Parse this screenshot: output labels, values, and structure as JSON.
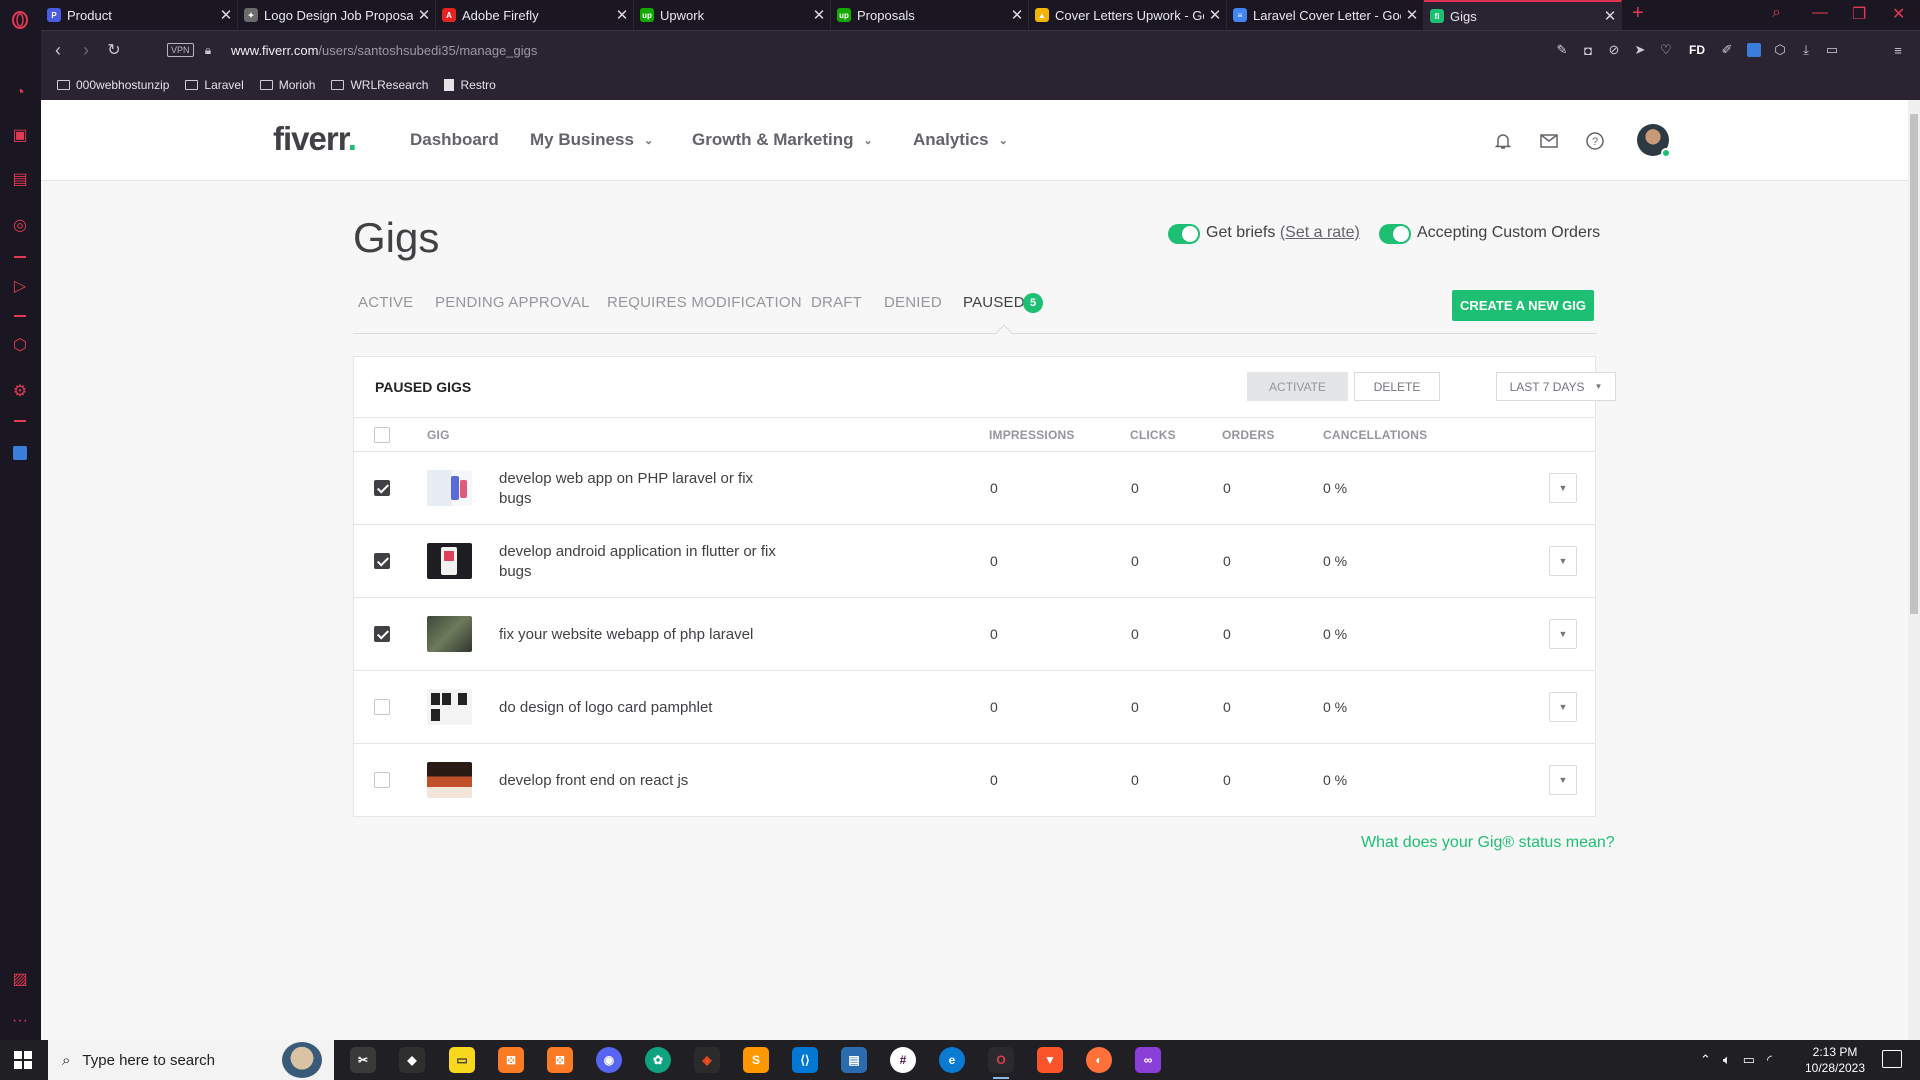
{
  "browser": {
    "tabs": [
      {
        "title": "Product",
        "color": "#4a5de0",
        "glyph": "P"
      },
      {
        "title": "Logo Design Job Proposal",
        "color": "#6b6b6b",
        "glyph": "✦"
      },
      {
        "title": "Adobe Firefly",
        "color": "#e52421",
        "glyph": "A"
      },
      {
        "title": "Upwork",
        "color": "#14a800",
        "glyph": "up"
      },
      {
        "title": "Proposals",
        "color": "#14a800",
        "glyph": "up"
      },
      {
        "title": "Cover Letters Upwork - Go",
        "color": "#f4b400",
        "glyph": "▲"
      },
      {
        "title": "Laravel Cover Letter - Goog",
        "color": "#4285f4",
        "glyph": "≡"
      },
      {
        "title": "Gigs",
        "color": "#1dbf73",
        "glyph": "fi"
      }
    ],
    "vpn_label": "VPN",
    "url_host": "www.fiverr.com",
    "url_path": "/users/santoshsubedi35/manage_gigs",
    "fd_label": "FD",
    "bookmarks": [
      "000webhostunzip",
      "Laravel",
      "Morioh",
      "WRLResearch",
      "Restro"
    ]
  },
  "fiverr": {
    "logo_text": "fiverr",
    "logo_dot": ".",
    "nav": [
      "Dashboard",
      "My Business",
      "Growth & Marketing",
      "Analytics"
    ],
    "page_title": "Gigs",
    "get_briefs_label": "Get briefs",
    "set_rate_link": "(Set a rate)",
    "custom_orders_label": "Accepting Custom Orders",
    "tabs": [
      "ACTIVE",
      "PENDING APPROVAL",
      "REQUIRES MODIFICATION",
      "DRAFT",
      "DENIED",
      "PAUSED"
    ],
    "paused_count": "5",
    "create_gig_label": "CREATE A NEW GIG",
    "panel": {
      "title": "PAUSED GIGS",
      "activate_label": "ACTIVATE",
      "delete_label": "DELETE",
      "range_label": "LAST 7 DAYS",
      "columns": [
        "GIG",
        "IMPRESSIONS",
        "CLICKS",
        "ORDERS",
        "CANCELLATIONS"
      ],
      "rows": [
        {
          "title": "develop web app on PHP laravel or fix bugs",
          "impressions": "0",
          "clicks": "0",
          "orders": "0",
          "cancellations": "0 %",
          "checked": true
        },
        {
          "title": "develop android application in flutter or fix bugs",
          "impressions": "0",
          "clicks": "0",
          "orders": "0",
          "cancellations": "0 %",
          "checked": true
        },
        {
          "title": "fix your website webapp of php laravel",
          "impressions": "0",
          "clicks": "0",
          "orders": "0",
          "cancellations": "0 %",
          "checked": true
        },
        {
          "title": "do design of logo card pamphlet",
          "impressions": "0",
          "clicks": "0",
          "orders": "0",
          "cancellations": "0 %",
          "checked": false
        },
        {
          "title": "develop front end on react js",
          "impressions": "0",
          "clicks": "0",
          "orders": "0",
          "cancellations": "0 %",
          "checked": false
        }
      ]
    },
    "status_link": "What does your Gig® status mean?",
    "accent_color": "#1dbf73"
  },
  "taskbar": {
    "search_placeholder": "Type here to search",
    "time": "2:13 PM",
    "date": "10/28/2023"
  }
}
